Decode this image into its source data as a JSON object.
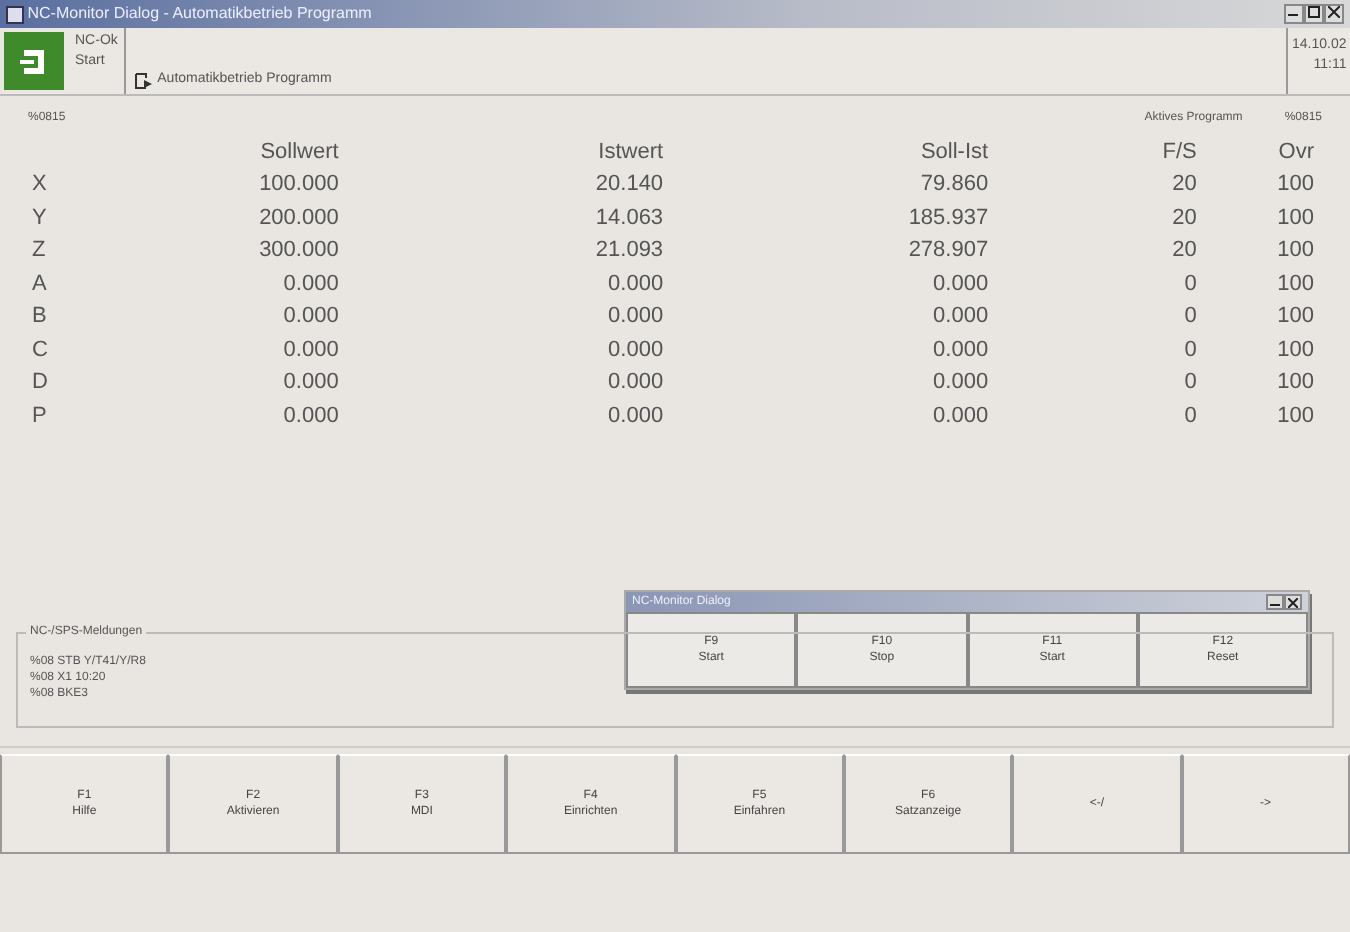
{
  "window": {
    "title": "NC-Monitor Dialog - Automatikbetrieb Programm"
  },
  "header": {
    "status": [
      "NC-Ok",
      "Start"
    ],
    "mode": "Automatikbetrieb Programm",
    "clock": [
      "14.10.02",
      "11:11"
    ]
  },
  "program": {
    "name": "%0815",
    "active_label": "Aktives Programm",
    "active_name": "%0815"
  },
  "table": {
    "columns": [
      "Sollwert",
      "Istwert",
      "Soll-Ist",
      "F/S",
      "Ovr"
    ],
    "rows": [
      {
        "axis": "X",
        "values": [
          "100.000",
          "20.140",
          "79.860",
          "20",
          "100"
        ]
      },
      {
        "axis": "Y",
        "values": [
          "200.000",
          "14.063",
          "185.937",
          "20",
          "100"
        ]
      },
      {
        "axis": "Z",
        "values": [
          "300.000",
          "21.093",
          "278.907",
          "20",
          "100"
        ]
      },
      {
        "axis": "A",
        "values": [
          "0.000",
          "0.000",
          "0.000",
          "0",
          "100"
        ]
      },
      {
        "axis": "B",
        "values": [
          "0.000",
          "0.000",
          "0.000",
          "0",
          "100"
        ]
      },
      {
        "axis": "C",
        "values": [
          "0.000",
          "0.000",
          "0.000",
          "0",
          "100"
        ]
      },
      {
        "axis": "D",
        "values": [
          "0.000",
          "0.000",
          "0.000",
          "0",
          "100"
        ]
      },
      {
        "axis": "P",
        "values": [
          "0.000",
          "0.000",
          "0.000",
          "0",
          "100"
        ]
      }
    ]
  },
  "popup": {
    "title": "NC-Monitor Dialog",
    "buttons": [
      {
        "key": "F9",
        "label": "Start"
      },
      {
        "key": "F10",
        "label": "Stop"
      },
      {
        "key": "F11",
        "label": "Start"
      },
      {
        "key": "F12",
        "label": "Reset"
      }
    ]
  },
  "messages": {
    "title": "NC-/SPS-Meldungen",
    "lines": [
      [
        "%08",
        "STB",
        "Y/T41/Y/R8"
      ],
      [
        "%08",
        "X1",
        "10:20"
      ],
      [
        "%08",
        "BKE3"
      ]
    ]
  },
  "softkeys": [
    {
      "key": "F1",
      "label": "Hilfe"
    },
    {
      "key": "F2",
      "label": "Aktivieren"
    },
    {
      "key": "F3",
      "label": "MDI"
    },
    {
      "key": "F4",
      "label": "Einrichten"
    },
    {
      "key": "F5",
      "label": "Einfahren"
    },
    {
      "key": "F6",
      "label": "Satzanzeige"
    },
    {
      "label": "<-/"
    },
    {
      "label": "->"
    }
  ]
}
